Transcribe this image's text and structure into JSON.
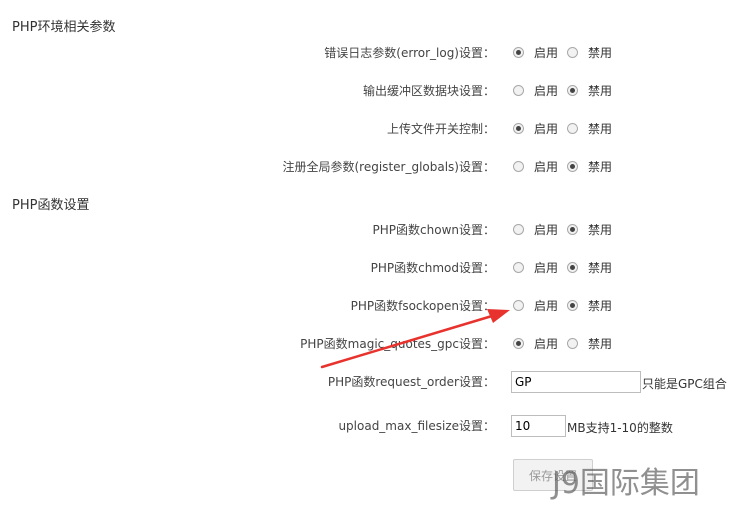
{
  "sections": {
    "env": "PHP环境相关参数",
    "func": "PHP函数设置"
  },
  "options": {
    "enable": "启用",
    "disable": "禁用"
  },
  "settings": [
    {
      "label": "错误日志参数(error_log)设置：",
      "enabled": true
    },
    {
      "label": "输出缓冲区数据块设置：",
      "enabled": false
    },
    {
      "label": "上传文件开关控制：",
      "enabled": true
    },
    {
      "label": "注册全局参数(register_globals)设置：",
      "enabled": false
    },
    {
      "label": "PHP函数chown设置：",
      "enabled": false
    },
    {
      "label": "PHP函数chmod设置：",
      "enabled": false
    },
    {
      "label": "PHP函数fsockopen设置：",
      "enabled": false
    },
    {
      "label": "PHP函数magic_quotes_gpc设置：",
      "enabled": true
    }
  ],
  "request_order": {
    "label": "PHP函数request_order设置：",
    "value": "GP",
    "hint": "只能是GPC组合"
  },
  "upload_max": {
    "label": "upload_max_filesize设置：",
    "value": "10",
    "hint": "MB支持1-10的整数"
  },
  "save_button": "保存设置",
  "watermark": "J9国际集团",
  "colors": {
    "arrow": "#e8322d",
    "selected": "#444444"
  }
}
